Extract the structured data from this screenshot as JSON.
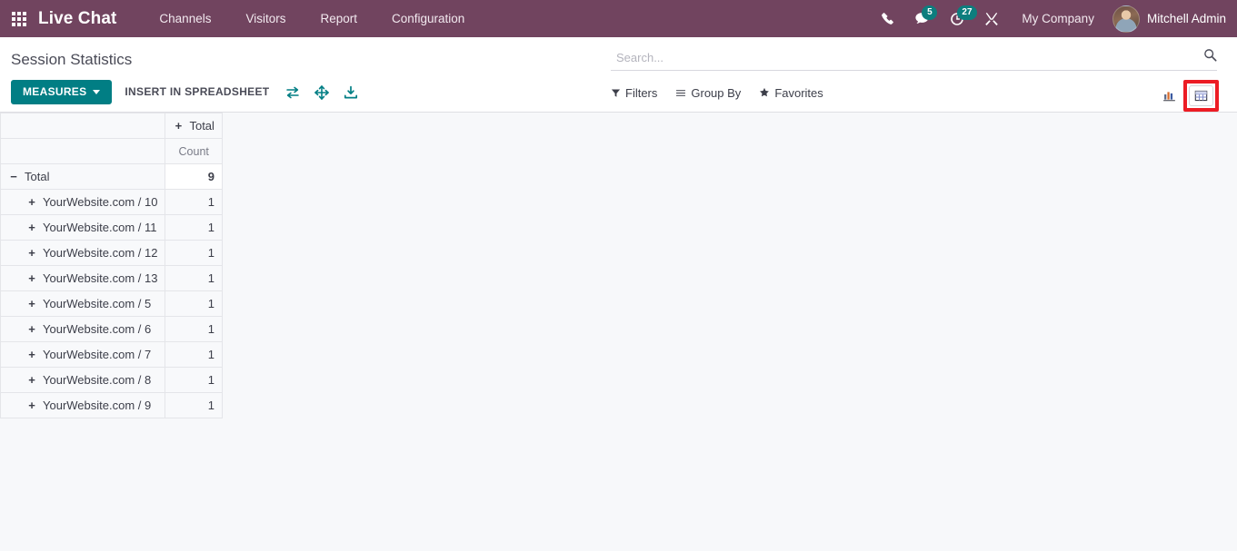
{
  "navbar": {
    "apps_icon": "apps-grid-icon",
    "brand": "Live Chat",
    "menu_items": [
      {
        "label": "Channels"
      },
      {
        "label": "Visitors"
      },
      {
        "label": "Report"
      },
      {
        "label": "Configuration"
      }
    ],
    "icons": {
      "phone": "phone-icon",
      "messages": "messages-icon",
      "activities": "activities-clock-icon",
      "debug": "debug-tools-icon"
    },
    "messages_count": "5",
    "activities_count": "27",
    "company": "My Company",
    "user": "Mitchell Admin",
    "background_color": "#71445f",
    "badge_color": "#0d7e7e"
  },
  "control_panel": {
    "title": "Session Statistics",
    "measures_button": "MEASURES",
    "insert_spreadsheet_button": "INSERT IN SPREADSHEET",
    "icon_buttons": [
      {
        "name": "flip-axis-icon"
      },
      {
        "name": "expand-all-icon"
      },
      {
        "name": "download-xlsx-icon"
      }
    ],
    "accent_color": "#017e84"
  },
  "search": {
    "placeholder": "Search...",
    "value": "",
    "icon": "search-icon"
  },
  "filters": [
    {
      "label": "Filters",
      "icon": "filter-funnel-icon"
    },
    {
      "label": "Group By",
      "icon": "group-by-lines-icon"
    },
    {
      "label": "Favorites",
      "icon": "favorites-star-icon"
    }
  ],
  "view_switcher": {
    "views": [
      {
        "name": "graph-view",
        "icon": "bar-chart-icon",
        "active": false
      },
      {
        "name": "pivot-view",
        "icon": "pivot-table-icon",
        "active": true
      }
    ],
    "highlight_color": "#ec1c24"
  },
  "pivot": {
    "column_header": "Total",
    "column_header_toggle": "+",
    "measure_header": "Count",
    "total_row": {
      "toggle": "−",
      "label": "Total",
      "value": "9"
    },
    "rows": [
      {
        "toggle": "+",
        "label": "YourWebsite.com / 10",
        "value": "1"
      },
      {
        "toggle": "+",
        "label": "YourWebsite.com / 11",
        "value": "1"
      },
      {
        "toggle": "+",
        "label": "YourWebsite.com / 12",
        "value": "1"
      },
      {
        "toggle": "+",
        "label": "YourWebsite.com / 13",
        "value": "1"
      },
      {
        "toggle": "+",
        "label": "YourWebsite.com / 5",
        "value": "1"
      },
      {
        "toggle": "+",
        "label": "YourWebsite.com / 6",
        "value": "1"
      },
      {
        "toggle": "+",
        "label": "YourWebsite.com / 7",
        "value": "1"
      },
      {
        "toggle": "+",
        "label": "YourWebsite.com / 8",
        "value": "1"
      },
      {
        "toggle": "+",
        "label": "YourWebsite.com / 9",
        "value": "1"
      }
    ]
  },
  "chart_data": {
    "type": "table",
    "title": "Session Statistics",
    "categories": [
      "YourWebsite.com / 10",
      "YourWebsite.com / 11",
      "YourWebsite.com / 12",
      "YourWebsite.com / 13",
      "YourWebsite.com / 5",
      "YourWebsite.com / 6",
      "YourWebsite.com / 7",
      "YourWebsite.com / 8",
      "YourWebsite.com / 9"
    ],
    "values": [
      1,
      1,
      1,
      1,
      1,
      1,
      1,
      1,
      1
    ],
    "measure": "Count",
    "total": 9,
    "xlabel": "",
    "ylabel": "Count"
  }
}
